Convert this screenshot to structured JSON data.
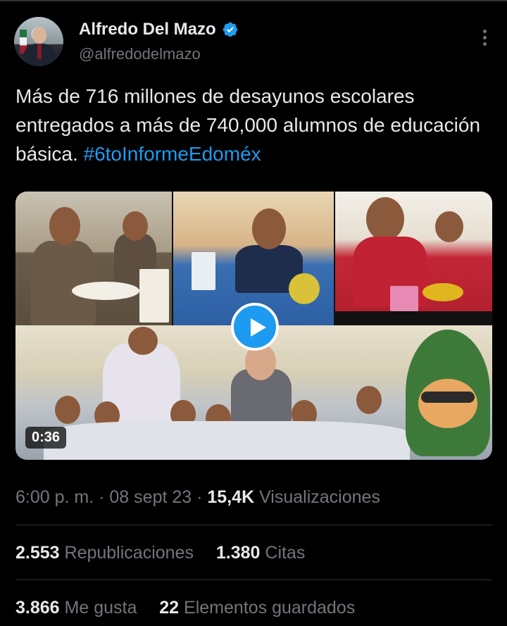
{
  "author": {
    "display_name": "Alfredo Del Mazo",
    "handle": "@alfredodelmazo",
    "verified_icon": "verified-badge-icon",
    "avatar_icon": "profile-avatar"
  },
  "tweet": {
    "text": "Más de 716 millones de desayunos escolares entregados a más de 740,000 alumnos de educación básica.",
    "hashtag": "#6toInformeEdoméx"
  },
  "media": {
    "type": "video",
    "duration": "0:36",
    "play_icon": "play-icon"
  },
  "meta": {
    "time": "6:00 p. m.",
    "separator": "·",
    "date": "08 sept 23",
    "views_count": "15,4K",
    "views_label": "Visualizaciones"
  },
  "stats": {
    "reposts_count": "2.553",
    "reposts_label": "Republicaciones",
    "quotes_count": "1.380",
    "quotes_label": "Citas",
    "likes_count": "3.866",
    "likes_label": "Me gusta",
    "bookmarks_count": "22",
    "bookmarks_label": "Elementos guardados"
  },
  "colors": {
    "background": "#000000",
    "text": "#e7e9ea",
    "secondary_text": "#71767b",
    "accent": "#1d9bf0",
    "divider": "#2f3336"
  }
}
